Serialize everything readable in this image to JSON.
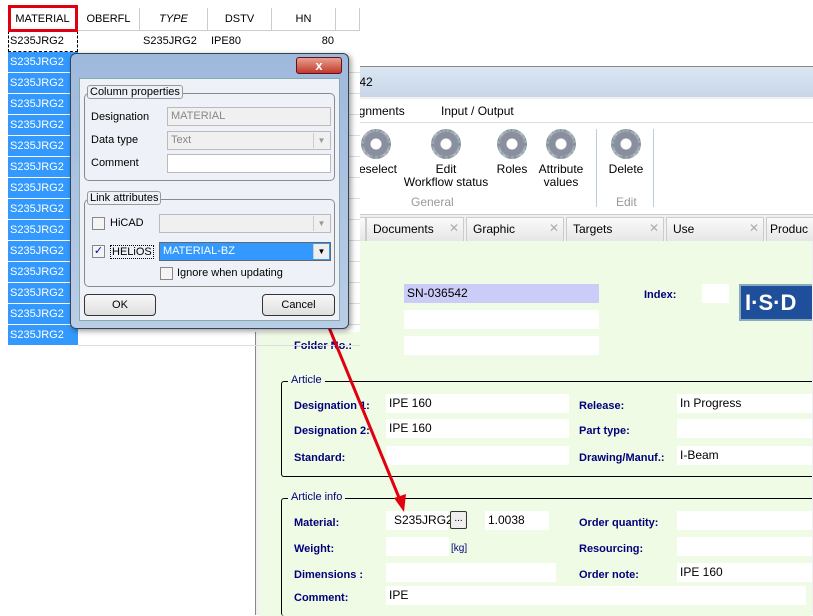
{
  "grid": {
    "headers": [
      "MATERIAL",
      "OBERFL",
      "TYPE",
      "DSTV",
      "HN"
    ],
    "first_row": [
      "S235JRG2",
      "",
      "S235JRG2",
      "IPE80",
      "80"
    ],
    "selected_rows": [
      "S235JRG2",
      "S235JRG2",
      "S235JRG2",
      "S235JRG2",
      "S235JRG2",
      "S235JRG2",
      "S235JRG2",
      "S235JRG2",
      "S235JRG2",
      "S235JRG2",
      "S235JRG2",
      "S235JRG2",
      "S235JRG2",
      "S235JRG2"
    ]
  },
  "window": {
    "title": "6542",
    "menu": [
      "ssignments",
      "Input / Output"
    ],
    "ribbon": {
      "buttons": [
        {
          "label": "reselect"
        },
        {
          "label": "Edit\nWorkflow status"
        },
        {
          "label": "Roles"
        },
        {
          "label": "Attribute values"
        },
        {
          "label": "Delete"
        }
      ],
      "groups": [
        "General",
        "Edit"
      ]
    },
    "tabs": [
      "Documents",
      "Graphic",
      "Targets",
      "Use",
      "Produc"
    ],
    "form": {
      "number": "SN-036542",
      "index_label": "Index:",
      "logo": "I·S·D",
      "folder_label": "Folder No.:",
      "article": {
        "title": "Article",
        "designation1_label": "Designation 1:",
        "designation1": "IPE 160",
        "designation2_label": "Designation 2:",
        "designation2": "IPE 160",
        "standard_label": "Standard:",
        "release_label": "Release:",
        "release": "In Progress",
        "parttype_label": "Part type:",
        "drawing_label": "Drawing/Manuf.:",
        "drawing": "I-Beam"
      },
      "info": {
        "title": "Article info",
        "material_label": "Material:",
        "material": "S235JRG2",
        "browse": "...",
        "material_no": "1.0038",
        "weight_label": "Weight:",
        "weight_unit": "[kg]",
        "dimensions_label": "Dimensions :",
        "comment_label": "Comment:",
        "comment": "IPE",
        "orderqty_label": "Order quantity:",
        "resourcing_label": "Resourcing:",
        "ordernote_label": "Order note:",
        "ordernote": "IPE 160"
      }
    }
  },
  "dialog": {
    "close": "x",
    "column_group": "Column properties",
    "designation_label": "Designation",
    "designation": "MATERIAL",
    "datatype_label": "Data type",
    "datatype": "Text",
    "comment_label": "Comment",
    "comment": "",
    "link_group": "Link attributes",
    "hicad_label": "HiCAD",
    "hicad_checked": false,
    "helios_label": "HELiOS",
    "helios_checked": true,
    "helios_value": "MATERIAL-BZ",
    "ignore_label": "Ignore when updating",
    "ignore_checked": false,
    "ok": "OK",
    "cancel": "Cancel"
  },
  "colors": {
    "selection": "#3399ff",
    "form_bg": "#f0fbe5",
    "label": "#00007a",
    "highlight": "#e00010"
  }
}
